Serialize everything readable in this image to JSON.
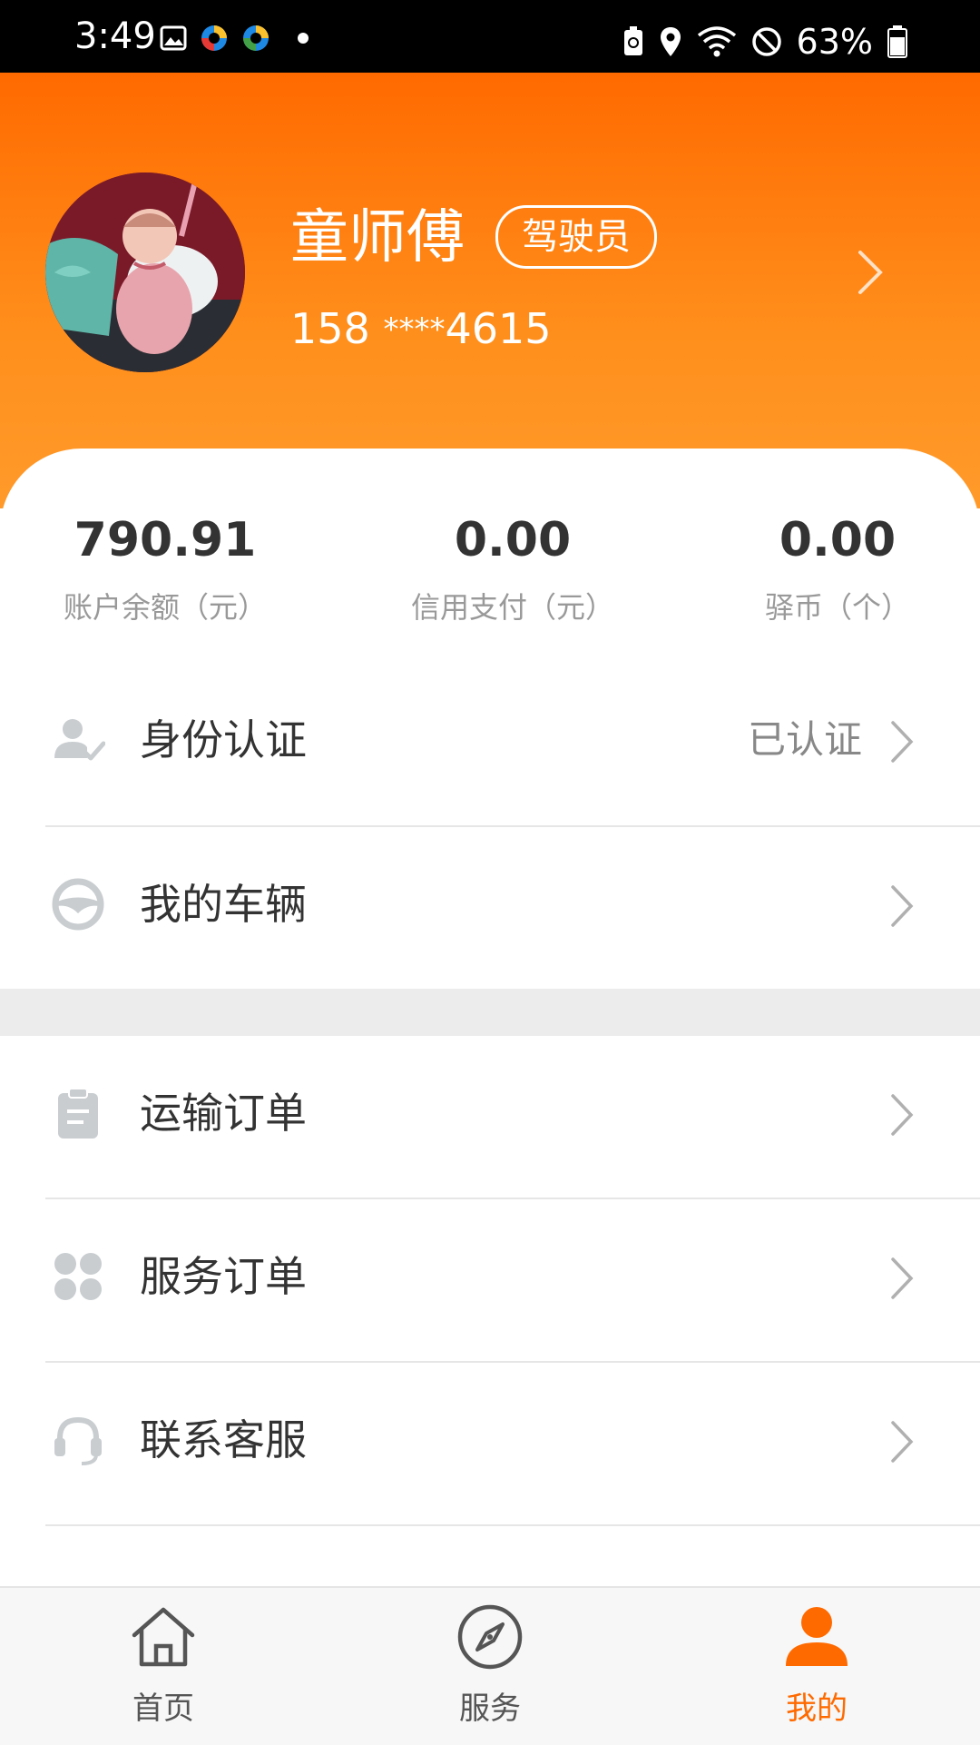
{
  "status_bar": {
    "time": "3:49",
    "battery_percent": "63%",
    "icons": [
      "image-icon",
      "app-icon",
      "app-icon",
      "dot-icon",
      "battery-saver-icon",
      "location-icon",
      "wifi-icon",
      "do-not-disturb-icon",
      "battery-icon"
    ]
  },
  "profile": {
    "name": "童师傅",
    "role": "驾驶员",
    "phone_prefix": "158",
    "phone_mask": "****",
    "phone_suffix": "4615",
    "avatar": "avatar-photo"
  },
  "stats": [
    {
      "value": "790.91",
      "label": "账户余额（元）"
    },
    {
      "value": "0.00",
      "label": "信用支付（元）"
    },
    {
      "value": "0.00",
      "label": "驿币（个）"
    }
  ],
  "menu_group_1": [
    {
      "label": "身份认证",
      "status": "已认证",
      "icon": "identity-verified-icon"
    },
    {
      "label": "我的车辆",
      "status": "",
      "icon": "steering-wheel-icon"
    }
  ],
  "menu_group_2": [
    {
      "label": "运输订单",
      "icon": "clipboard-icon"
    },
    {
      "label": "服务订单",
      "icon": "grid-icon"
    },
    {
      "label": "联系客服",
      "icon": "headset-icon"
    }
  ],
  "tabs": [
    {
      "label": "首页",
      "icon": "home-icon",
      "active": false
    },
    {
      "label": "服务",
      "icon": "compass-icon",
      "active": false
    },
    {
      "label": "我的",
      "icon": "user-icon",
      "active": true
    }
  ],
  "colors": {
    "brand_orange": "#ff6a00",
    "header_gradient_end": "#ff9a2a",
    "icon_gray": "#c9cdd0"
  }
}
